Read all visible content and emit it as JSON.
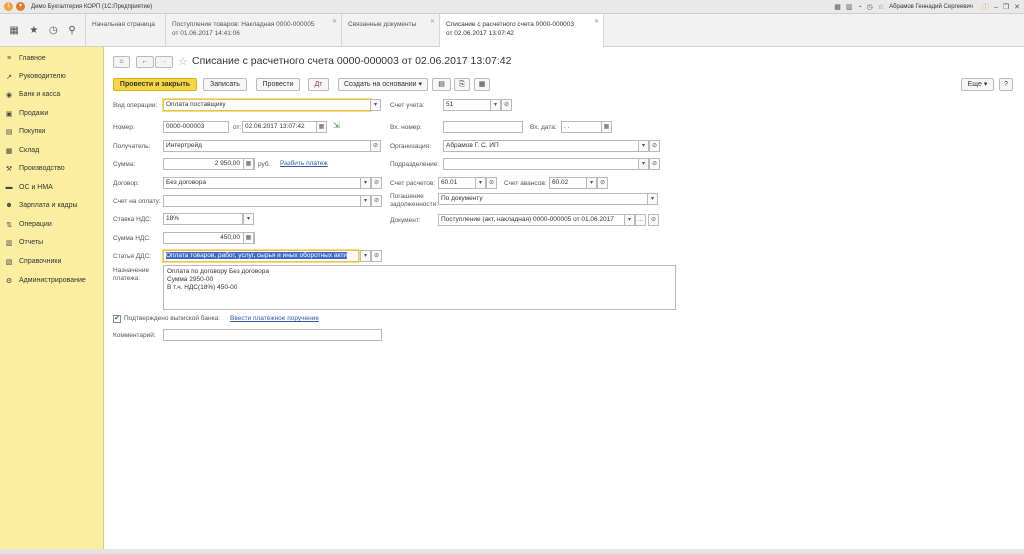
{
  "app": {
    "title": "Демо Бухгалтерия КОРП  (1С:Предприятие)",
    "user": "Абрамов Геннадий Сергеевич"
  },
  "tabs": [
    {
      "label": "Начальная страница",
      "label2": ""
    },
    {
      "label": "Поступление товаров: Накладная 0000-000005",
      "label2": "от 01.06.2017 14:41:06"
    },
    {
      "label": "Связанные документы",
      "label2": ""
    },
    {
      "label": "Списание с расчетного счета 0000-000003",
      "label2": "от 02.06.2017 13:07:42"
    }
  ],
  "sidebar": {
    "items": [
      {
        "label": "Главное",
        "icon": "≡"
      },
      {
        "label": "Руководителю",
        "icon": "↗"
      },
      {
        "label": "Банк и касса",
        "icon": "◉"
      },
      {
        "label": "Продажи",
        "icon": "▣"
      },
      {
        "label": "Покупки",
        "icon": "▤"
      },
      {
        "label": "Склад",
        "icon": "▦"
      },
      {
        "label": "Производство",
        "icon": "⚒"
      },
      {
        "label": "ОС и НМА",
        "icon": "▬"
      },
      {
        "label": "Зарплата и кадры",
        "icon": "☻"
      },
      {
        "label": "Операции",
        "icon": "⇅"
      },
      {
        "label": "Отчеты",
        "icon": "▥"
      },
      {
        "label": "Справочники",
        "icon": "▧"
      },
      {
        "label": "Администрирование",
        "icon": "⚙"
      }
    ]
  },
  "doc": {
    "title": "Списание с расчетного счета 0000-000003 от 02.06.2017 13:07:42"
  },
  "toolbar": {
    "post_close": "Провести и закрыть",
    "save": "Записать",
    "post": "Провести",
    "create_based": "Создать на основании",
    "more": "Еще",
    "help": "?"
  },
  "form": {
    "op_type_label": "Вид операции:",
    "op_type_value": "Оплата поставщику",
    "number_label": "Номер:",
    "number_value": "0000-000003",
    "date_label": "от:",
    "date_value": "02.06.2017 13:07:42",
    "recipient_label": "Получатель:",
    "recipient_value": "Интертрейд",
    "sum_label": "Сумма:",
    "sum_value": "2 950,00",
    "currency": "руб.",
    "split_link": "Разбить платеж",
    "contract_label": "Договор:",
    "contract_value": "Без договора",
    "invoice_label": "Счет на оплату:",
    "invoice_value": "",
    "vat_rate_label": "Ставка НДС:",
    "vat_rate_value": "18%",
    "vat_sum_label": "Сумма НДС:",
    "vat_sum_value": "450,00",
    "dds_label": "Статья ДДС:",
    "dds_value": "Оплата товаров, работ, услуг, сырья и иных оборотных акти",
    "purpose_label1": "Назначение",
    "purpose_label2": "платежа:",
    "purpose_value": "Оплата по договору Без договора\nСумма 2950-00\nВ т.ч. НДС(18%) 450-00",
    "confirmed_label": "Подтверждено выпиской банка:",
    "enter_order_link": "Ввести платежное поручение",
    "comment_label": "Комментарий:",
    "comment_value": "",
    "account_label": "Счет учета:",
    "account_value": "51",
    "in_number_label": "Вх. номер:",
    "in_number_value": "",
    "in_date_label": "Вх. дата:",
    "in_date_value": " .  .",
    "org_label": "Организация:",
    "org_value": "Абрамов Г. С. ИП",
    "dept_label": "Подразделение:",
    "dept_value": "",
    "settle_acc_label": "Счет расчетов:",
    "settle_acc_value": "60.01",
    "advance_acc_label": "Счет авансов:",
    "advance_acc_value": "60.02",
    "debt_label1": "Погашение",
    "debt_label2": "задолженности:",
    "debt_value": "По документу",
    "document_label": "Документ:",
    "document_value": "Поступление (акт, накладная) 0000-000005 от 01.06.2017"
  }
}
